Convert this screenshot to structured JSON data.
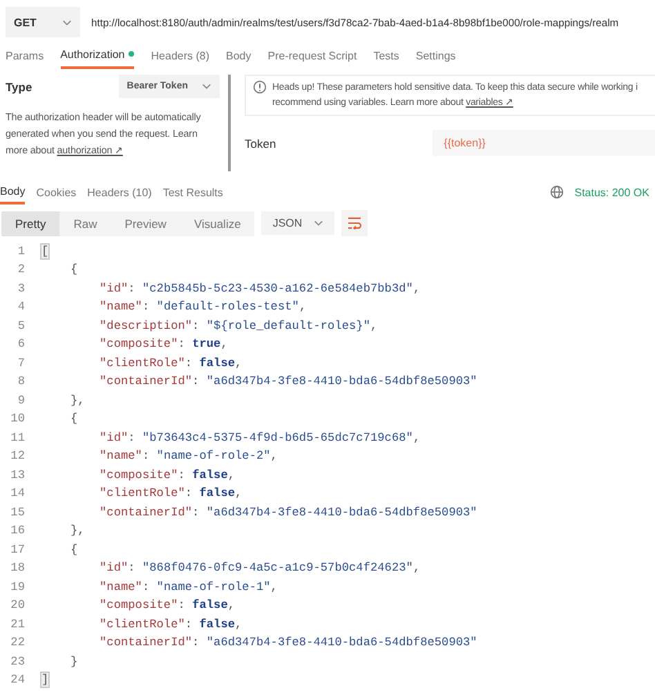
{
  "request": {
    "method": "GET",
    "url": "http://localhost:8180/auth/admin/realms/test/users/f3d78ca2-7bab-4aed-b1a4-8b98bf1be000/role-mappings/realm"
  },
  "request_tabs": [
    {
      "label": "Params",
      "selected": false,
      "dot": false
    },
    {
      "label": "Authorization",
      "selected": true,
      "dot": true
    },
    {
      "label": "Headers (8)",
      "selected": false,
      "dot": false
    },
    {
      "label": "Body",
      "selected": false,
      "dot": false
    },
    {
      "label": "Pre-request Script",
      "selected": false,
      "dot": false
    },
    {
      "label": "Tests",
      "selected": false,
      "dot": false
    },
    {
      "label": "Settings",
      "selected": false,
      "dot": false
    }
  ],
  "auth": {
    "type_label": "Type",
    "type_value": "Bearer Token",
    "help": "The authorization header will be automatically generated when you send the request. Learn more about",
    "help_link": "authorization ↗",
    "notice": "Heads up! These parameters hold sensitive data. To keep this data secure while working i",
    "notice_2": "recommend using variables. Learn more about",
    "notice_link": "variables ↗",
    "token_label": "Token",
    "token_value": "{{token}}"
  },
  "response_tabs": [
    {
      "label": "Body",
      "selected": true
    },
    {
      "label": "Cookies",
      "selected": false
    },
    {
      "label": "Headers (10)",
      "selected": false
    },
    {
      "label": "Test Results",
      "selected": false
    }
  ],
  "status": "Status: 200 OK",
  "view_modes": [
    {
      "label": "Pretty",
      "selected": true
    },
    {
      "label": "Raw",
      "selected": false
    },
    {
      "label": "Preview",
      "selected": false
    },
    {
      "label": "Visualize",
      "selected": false
    }
  ],
  "format": "JSON",
  "code": [
    {
      "n": "1",
      "kind": "outer",
      "parts": [
        {
          "kind": "punct",
          "text": "["
        }
      ]
    },
    {
      "n": "2",
      "kind": "brace",
      "parts": [
        {
          "kind": "punct",
          "text": "{"
        }
      ]
    },
    {
      "n": "3",
      "kind": "field",
      "parts": [
        {
          "kind": "key",
          "text": "\"id\""
        },
        {
          "kind": "punct",
          "text": ": "
        },
        {
          "kind": "string",
          "text": "\"c2b5845b-5c23-4530-a162-6e584eb7bb3d\""
        },
        {
          "kind": "punct",
          "text": ","
        }
      ]
    },
    {
      "n": "4",
      "kind": "field",
      "parts": [
        {
          "kind": "key",
          "text": "\"name\""
        },
        {
          "kind": "punct",
          "text": ": "
        },
        {
          "kind": "string",
          "text": "\"default-roles-test\""
        },
        {
          "kind": "punct",
          "text": ","
        }
      ]
    },
    {
      "n": "5",
      "kind": "field",
      "parts": [
        {
          "kind": "key",
          "text": "\"description\""
        },
        {
          "kind": "punct",
          "text": ": "
        },
        {
          "kind": "string",
          "text": "\"${role_default-roles}\""
        },
        {
          "kind": "punct",
          "text": ","
        }
      ]
    },
    {
      "n": "6",
      "kind": "field",
      "parts": [
        {
          "kind": "key",
          "text": "\"composite\""
        },
        {
          "kind": "punct",
          "text": ": "
        },
        {
          "kind": "bool",
          "text": "true"
        },
        {
          "kind": "punct",
          "text": ","
        }
      ]
    },
    {
      "n": "7",
      "kind": "field",
      "parts": [
        {
          "kind": "key",
          "text": "\"clientRole\""
        },
        {
          "kind": "punct",
          "text": ": "
        },
        {
          "kind": "bool",
          "text": "false"
        },
        {
          "kind": "punct",
          "text": ","
        }
      ]
    },
    {
      "n": "8",
      "kind": "field",
      "parts": [
        {
          "kind": "key",
          "text": "\"containerId\""
        },
        {
          "kind": "punct",
          "text": ": "
        },
        {
          "kind": "string",
          "text": "\"a6d347b4-3fe8-4410-bda6-54dbf8e50903\""
        }
      ]
    },
    {
      "n": "9",
      "kind": "brace",
      "parts": [
        {
          "kind": "punct",
          "text": "},"
        }
      ]
    },
    {
      "n": "10",
      "kind": "brace",
      "parts": [
        {
          "kind": "punct",
          "text": "{"
        }
      ]
    },
    {
      "n": "11",
      "kind": "field",
      "parts": [
        {
          "kind": "key",
          "text": "\"id\""
        },
        {
          "kind": "punct",
          "text": ": "
        },
        {
          "kind": "string",
          "text": "\"b73643c4-5375-4f9d-b6d5-65dc7c719c68\""
        },
        {
          "kind": "punct",
          "text": ","
        }
      ]
    },
    {
      "n": "12",
      "kind": "field",
      "parts": [
        {
          "kind": "key",
          "text": "\"name\""
        },
        {
          "kind": "punct",
          "text": ": "
        },
        {
          "kind": "string",
          "text": "\"name-of-role-2\""
        },
        {
          "kind": "punct",
          "text": ","
        }
      ]
    },
    {
      "n": "13",
      "kind": "field",
      "parts": [
        {
          "kind": "key",
          "text": "\"composite\""
        },
        {
          "kind": "punct",
          "text": ": "
        },
        {
          "kind": "bool",
          "text": "false"
        },
        {
          "kind": "punct",
          "text": ","
        }
      ]
    },
    {
      "n": "14",
      "kind": "field",
      "parts": [
        {
          "kind": "key",
          "text": "\"clientRole\""
        },
        {
          "kind": "punct",
          "text": ": "
        },
        {
          "kind": "bool",
          "text": "false"
        },
        {
          "kind": "punct",
          "text": ","
        }
      ]
    },
    {
      "n": "15",
      "kind": "field",
      "parts": [
        {
          "kind": "key",
          "text": "\"containerId\""
        },
        {
          "kind": "punct",
          "text": ": "
        },
        {
          "kind": "string",
          "text": "\"a6d347b4-3fe8-4410-bda6-54dbf8e50903\""
        }
      ]
    },
    {
      "n": "16",
      "kind": "brace",
      "parts": [
        {
          "kind": "punct",
          "text": "},"
        }
      ]
    },
    {
      "n": "17",
      "kind": "brace",
      "parts": [
        {
          "kind": "punct",
          "text": "{"
        }
      ]
    },
    {
      "n": "18",
      "kind": "field",
      "parts": [
        {
          "kind": "key",
          "text": "\"id\""
        },
        {
          "kind": "punct",
          "text": ": "
        },
        {
          "kind": "string",
          "text": "\"868f0476-0fc9-4a5c-a1c9-57b0c4f24623\""
        },
        {
          "kind": "punct",
          "text": ","
        }
      ]
    },
    {
      "n": "19",
      "kind": "field",
      "parts": [
        {
          "kind": "key",
          "text": "\"name\""
        },
        {
          "kind": "punct",
          "text": ": "
        },
        {
          "kind": "string",
          "text": "\"name-of-role-1\""
        },
        {
          "kind": "punct",
          "text": ","
        }
      ]
    },
    {
      "n": "20",
      "kind": "field",
      "parts": [
        {
          "kind": "key",
          "text": "\"composite\""
        },
        {
          "kind": "punct",
          "text": ": "
        },
        {
          "kind": "bool",
          "text": "false"
        },
        {
          "kind": "punct",
          "text": ","
        }
      ]
    },
    {
      "n": "21",
      "kind": "field",
      "parts": [
        {
          "kind": "key",
          "text": "\"clientRole\""
        },
        {
          "kind": "punct",
          "text": ": "
        },
        {
          "kind": "bool",
          "text": "false"
        },
        {
          "kind": "punct",
          "text": ","
        }
      ]
    },
    {
      "n": "22",
      "kind": "field",
      "parts": [
        {
          "kind": "key",
          "text": "\"containerId\""
        },
        {
          "kind": "punct",
          "text": ": "
        },
        {
          "kind": "string",
          "text": "\"a6d347b4-3fe8-4410-bda6-54dbf8e50903\""
        }
      ]
    },
    {
      "n": "23",
      "kind": "brace",
      "parts": [
        {
          "kind": "punct",
          "text": "}"
        }
      ]
    },
    {
      "n": "24",
      "kind": "outer",
      "parts": [
        {
          "kind": "punct",
          "text": "]"
        }
      ]
    }
  ]
}
